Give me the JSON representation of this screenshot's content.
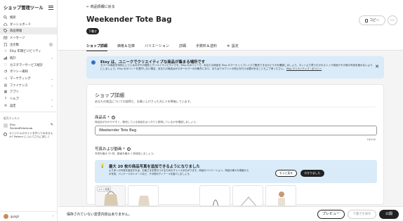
{
  "sidebar": {
    "title": "ショップ管理ツール",
    "items": [
      {
        "label": "検索",
        "icon": "search-icon"
      },
      {
        "label": "ダッシュボード",
        "icon": "home-icon"
      },
      {
        "label": "商品情報",
        "icon": "tag-icon",
        "active": true
      },
      {
        "label": "メッセージ",
        "icon": "mail-icon"
      },
      {
        "label": "注文数",
        "icon": "receipt-icon",
        "badge": "5"
      },
      {
        "label": "Etsy 年間ビジビリティ",
        "icon": "star-icon"
      },
      {
        "label": "統計",
        "icon": "chart-icon"
      },
      {
        "label": "カスタマーサービス統計",
        "icon": "support-icon"
      },
      {
        "label": "ボリシー通知",
        "icon": "bell-icon"
      },
      {
        "label": "マーケティング",
        "icon": "megaphone-icon"
      },
      {
        "label": "ファイナンス",
        "icon": "bank-icon"
      },
      {
        "label": "アプリ",
        "icon": "apps-icon"
      },
      {
        "label": "ヘルプ",
        "icon": "help-icon"
      },
      {
        "label": "設定",
        "icon": "gear-icon"
      }
    ],
    "channels_heading": "販売チャネル",
    "channel_line1": "Etsy",
    "channel_line2": "PaintedPetalsLab",
    "promo_text": "オリジナルのサイトを作ってみませんか?",
    "promo_text2": "Pattern についてさらに詳しく",
    "user_name": "guzgli"
  },
  "header": {
    "back_link": "← 商品情報に戻る",
    "title": "Weekender Tote Bag",
    "status": "下書き",
    "copy_label": "コピー",
    "more_label": "…"
  },
  "tabs": [
    {
      "label": "ショップ詳細",
      "active": true
    },
    {
      "label": "価格＆在庫"
    },
    {
      "label": "バリエーション"
    },
    {
      "label": "詳細"
    },
    {
      "label": "手数料＆送料"
    },
    {
      "label": "設定",
      "icon": "gear-icon"
    }
  ],
  "banner": {
    "title": "Etsy は、ユニークでクリエイティブな商品が集まる場所です",
    "body": "セラーの商品を特別にしているのがその個性とクリエイティビティです。Etsy のポリシーで、あなたの商品を Etsy のマーケットプレイスで販売できるかどうかを確認しましょう。ネットより買うだけのストック商品やその他の写真を使わないようにしましょう。Etsy のポリシーを遵守しない場合、あなたの商品はがスターセラーの対象外になり、またはアカウントの停止を行う必要があることもご了承ください。",
    "link": "Etsy クリエイティブ・ポリシー"
  },
  "details": {
    "title": "ショップ詳細",
    "subtitle": "あなたの商品についての説明と、お買い上げさった方に人を降価しています。",
    "name_label": "商品名",
    "name_help": "商品名が分かりやすく、販売している商品をはっきりと説明しているかを確認しましょう。",
    "name_value": "Weekender Tote Bag",
    "counter": "18/140",
    "photos_label": "写真および動画",
    "photos_help": "写真を最大 20 枚、動画を最大 1 枚追加しましょう。",
    "notice_title": "最大 20 枚の商品写真を追加できるようになりました",
    "notice_body": "より多くの写真を追加すれば、お客さまを惹きつけるためのチャンスが広がります。商品のバリエーション、商品の様々な角度からの写真、パッケージのイメージなど、その他のディテールを紹介しましょう。",
    "learn_more": "もっと見る",
    "got_it": "わかりました",
    "main_photo_badge": "メイン写真"
  },
  "footer": {
    "unsaved": "保存されていない変更内容はありません。",
    "preview": "プレビュー",
    "save_draft": "下書きを保存",
    "publish": "公開"
  }
}
